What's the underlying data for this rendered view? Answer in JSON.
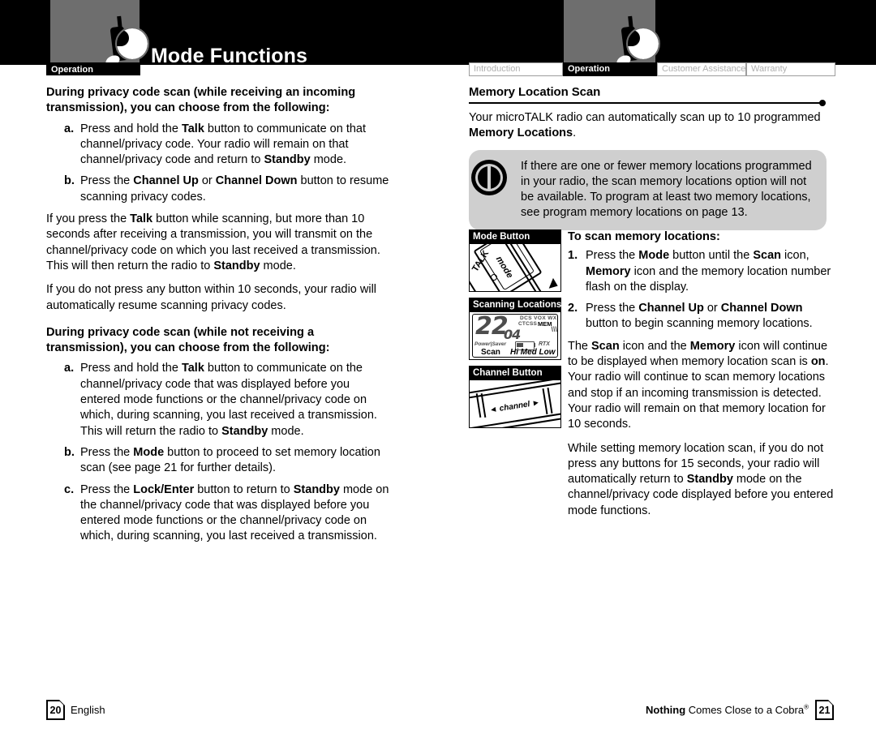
{
  "header": {
    "title": "Mode Functions",
    "section_tab_left": "Operation",
    "tabs": [
      {
        "label": "Introduction",
        "active": false
      },
      {
        "label": "Operation",
        "active": true
      },
      {
        "label": "Customer Assistance",
        "active": false
      },
      {
        "label": "Warranty",
        "active": false
      }
    ]
  },
  "left_column": {
    "block1": {
      "lead": "During privacy code scan (while receiving an incoming transmission), you can choose from the following:",
      "items": [
        {
          "marker": "a.",
          "html": "Press and hold the <b>Talk</b> button to communicate on that channel/privacy code. Your radio will remain on that channel/privacy code and return to <b>Standby</b> mode."
        },
        {
          "marker": "b.",
          "html": "Press the <b>Channel Up</b> or <b>Channel Down</b> button to resume scanning privacy codes."
        }
      ],
      "para1": "If you press the <b>Talk</b> button while scanning, but more than 10 seconds after receiving a transmission, you will transmit on the channel/privacy code on which you last received a transmission. This will then return the radio to <b>Standby</b> mode.",
      "para2": "If you do not press any button within 10 seconds, your radio will automatically resume scanning privacy codes."
    },
    "block2": {
      "lead": "During privacy code scan (while not receiving a transmission), you can choose from the following:",
      "items": [
        {
          "marker": "a.",
          "html": "Press and hold the <b>Talk</b> button to communicate on the channel/privacy code that was displayed before you entered mode functions or the channel/privacy code on which, during scanning, you last received a transmission. This will return the radio to <b>Standby</b> mode."
        },
        {
          "marker": "b.",
          "html": "Press the <b>Mode</b> button to proceed to set memory location scan (see page 21 for further details)."
        },
        {
          "marker": "c.",
          "html": "Press the <b>Lock/Enter</b> button to return to <b>Standby</b> mode on the channel/privacy code that was displayed before you entered mode functions or the channel/privacy code on which, during scanning, you last received a transmission."
        }
      ]
    }
  },
  "right_column": {
    "heading": "Memory Location Scan",
    "intro": "Your microTALK radio can automatically scan up to 10 programmed <b>Memory Locations</b>.",
    "note": "If there are one or fewer memory locations programmed in your radio, the scan memory locations option will not be available. To program at least two memory locations, see program memory locations on page 13.",
    "sub_lead": "To scan memory locations:",
    "steps": [
      {
        "marker": "1.",
        "html": "Press the <b>Mode</b> button until the <b>Scan</b> icon, <b>Memory</b> icon and the memory location number flash on the display."
      },
      {
        "marker": "2.",
        "html": "Press the <b>Channel Up</b> or <b>Channel Down</b> button to begin scanning memory locations."
      }
    ],
    "para1": "The <b>Scan</b> icon and the <b>Memory</b> icon will continue to be displayed when memory location scan is <b>on</b>. Your radio will continue to scan memory locations and stop if an incoming transmission is detected. Your radio will remain on that memory location for 10 seconds.",
    "para2": "While setting memory location scan, if you do not press any buttons for 15 seconds, your radio will automatically return to <b>Standby</b> mode on the channel/privacy code displayed before you entered mode functions."
  },
  "figures": [
    {
      "caption": "Mode Button",
      "art": "mode-button-photo",
      "labels": {
        "mode": "mode",
        "talk": "TALK"
      }
    },
    {
      "caption": "Scanning Locations",
      "art": "lcd-display",
      "lcd": {
        "channel": "22",
        "code": "04",
        "top_row1": "DCS VOX WX",
        "top_row2": "CTCSS",
        "memory": "MEM",
        "power_saver": "Power|Saver",
        "rtx": "RTX",
        "scan": "Scan",
        "power_levels": "Hi Med Low"
      }
    },
    {
      "caption": "Channel Button",
      "art": "channel-button-photo",
      "labels": {
        "channel": "◄  channel  ►"
      }
    }
  ],
  "footer": {
    "left_page": "20",
    "left_label": "English",
    "right_tagline_bold": "Nothing",
    "right_tagline_rest": " Comes Close to a Cobra",
    "right_tagline_mark": "®",
    "right_page": "21"
  },
  "colors": {
    "header_black": "#000000",
    "header_gray": "#6e6e6e",
    "note_gray": "#cfcfcf",
    "tab_inactive_text": "#b0b0b0",
    "lcd_gray": "#4d4d4d"
  }
}
